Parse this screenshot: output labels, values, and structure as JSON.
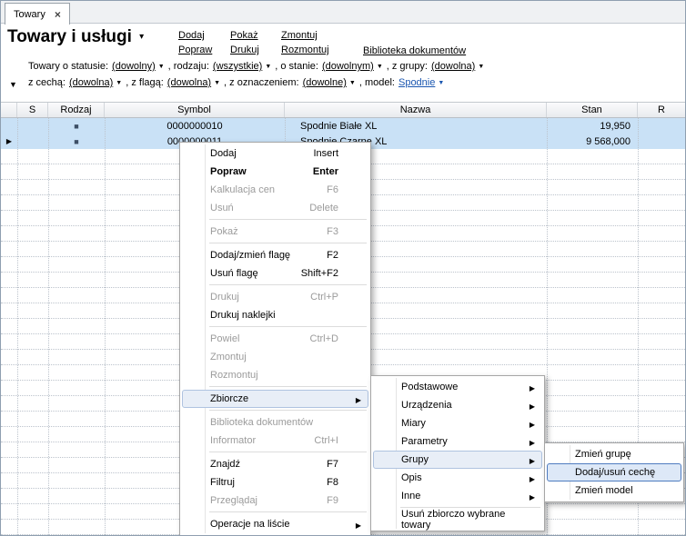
{
  "icons": {
    "close": "×",
    "dropdown_arrow": "▼",
    "filters_toggle": "▼",
    "submenu_arrow": "▶",
    "row_marker": "▶",
    "title_caret": "▾",
    "item_type_square": "■"
  },
  "tab": {
    "label": "Towary"
  },
  "header": {
    "title": "Towary i usługi",
    "links": {
      "col1": [
        "Dodaj",
        "Popraw"
      ],
      "col2": [
        "Pokaż",
        "Drukuj"
      ],
      "col3": [
        "Zmontuj",
        "Rozmontuj"
      ],
      "col4": [
        "Biblioteka dokumentów"
      ]
    }
  },
  "filters": {
    "row1": [
      {
        "label": "Towary o statusie:",
        "value": "(dowolny)"
      },
      {
        "label": ", rodzaju:",
        "value": "(wszystkie)"
      },
      {
        "label": ", o stanie:",
        "value": "(dowolnym)"
      },
      {
        "label": ", z grupy:",
        "value": "(dowolna)"
      }
    ],
    "row2": [
      {
        "label": "z cechą:",
        "value": "(dowolna)"
      },
      {
        "label": ", z flagą:",
        "value": "(dowolna)"
      },
      {
        "label": ", z oznaczeniem:",
        "value": "(dowolne)"
      },
      {
        "label": ", model:",
        "value": "Spodnie"
      }
    ]
  },
  "table": {
    "columns": {
      "marker": "",
      "s": "S",
      "rodzaj": "Rodzaj",
      "symbol": "Symbol",
      "nazwa": "Nazwa",
      "stan": "Stan",
      "r": "R"
    },
    "rows": [
      {
        "symbol": "0000000010",
        "nazwa": "Spodnie Białe XL",
        "stan": "19,950"
      },
      {
        "symbol": "0000000011",
        "nazwa": "Spodnie Czarne XL",
        "stan": "9 568,000"
      }
    ]
  },
  "context_menu": {
    "items": [
      {
        "label": "Dodaj",
        "shortcut": "Insert"
      },
      {
        "label": "Popraw",
        "shortcut": "Enter"
      },
      {
        "label": "Kalkulacja cen",
        "shortcut": "F6"
      },
      {
        "label": "Usuń",
        "shortcut": "Delete"
      },
      {
        "label": "Pokaż",
        "shortcut": "F3"
      },
      {
        "label": "Dodaj/zmień flagę",
        "shortcut": "F2"
      },
      {
        "label": "Usuń flagę",
        "shortcut": "Shift+F2"
      },
      {
        "label": "Drukuj",
        "shortcut": "Ctrl+P"
      },
      {
        "label": "Drukuj naklejki",
        "shortcut": ""
      },
      {
        "label": "Powiel",
        "shortcut": "Ctrl+D"
      },
      {
        "label": "Zmontuj",
        "shortcut": ""
      },
      {
        "label": "Rozmontuj",
        "shortcut": ""
      },
      {
        "label": "Zbiorcze",
        "shortcut": ""
      },
      {
        "label": "Biblioteka dokumentów",
        "shortcut": ""
      },
      {
        "label": "Informator",
        "shortcut": "Ctrl+I"
      },
      {
        "label": "Znajdź",
        "shortcut": "F7"
      },
      {
        "label": "Filtruj",
        "shortcut": "F8"
      },
      {
        "label": "Przeglądaj",
        "shortcut": "F9"
      },
      {
        "label": "Operacje na liście",
        "shortcut": ""
      }
    ]
  },
  "zbiorcze_submenu": {
    "items": [
      {
        "label": "Podstawowe"
      },
      {
        "label": "Urządzenia"
      },
      {
        "label": "Miary"
      },
      {
        "label": "Parametry"
      },
      {
        "label": "Grupy"
      },
      {
        "label": "Opis"
      },
      {
        "label": "Inne"
      },
      {
        "label": "Usuń zbiorczo wybrane towary"
      }
    ]
  },
  "grupy_submenu": {
    "items": [
      {
        "label": "Zmień grupę"
      },
      {
        "label": "Dodaj/usuń cechę"
      },
      {
        "label": "Zmień model"
      }
    ]
  }
}
